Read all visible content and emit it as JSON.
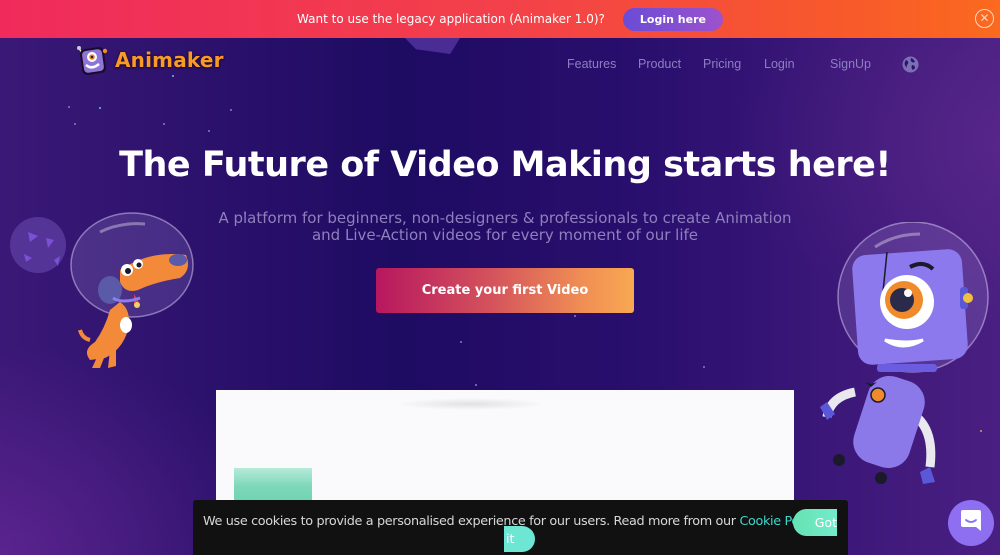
{
  "banner": {
    "text": "Want to use the legacy application (Animaker 1.0)?",
    "button_label": "Login here",
    "close_icon": "close-circle-icon",
    "close_glyph": "✕"
  },
  "brand": {
    "name": "Animaker",
    "logo_icon": "animaker-robot-logo-icon",
    "color": "#fa9a26"
  },
  "nav": {
    "items": [
      {
        "label": "Features"
      },
      {
        "label": "Product"
      },
      {
        "label": "Pricing"
      },
      {
        "label": "Login"
      },
      {
        "label": "SignUp"
      }
    ],
    "language_icon": "globe-icon"
  },
  "hero": {
    "title": "The Future of Video Making starts here!",
    "subtitle_line1": "A platform for beginners, non-designers & professionals to create Animation",
    "subtitle_line2": "and Live-Action videos for every moment of our life",
    "cta_label": "Create your first Video"
  },
  "illustrations": {
    "left": "astronaut-dog-illustration",
    "right": "astronaut-robot-illustration",
    "planet": "planet-illustration"
  },
  "cookie_bar": {
    "text": "We use cookies to provide a personalised experience for our users. Read more from our ",
    "link_label": "Cookie Policy.",
    "button_label_part1": "Got",
    "button_label_part2": "it"
  },
  "chat": {
    "icon": "chat-bubble-icon"
  },
  "colors": {
    "banner_start": "#f02b5c",
    "banner_end": "#fb6a1e",
    "background": "#1e0b62",
    "nav_text": "#8d7fc0",
    "cta_start": "#b7175f",
    "cta_end": "#f8a852",
    "cookie_link": "#3fd7c8",
    "chat": "#8e6ff2"
  }
}
